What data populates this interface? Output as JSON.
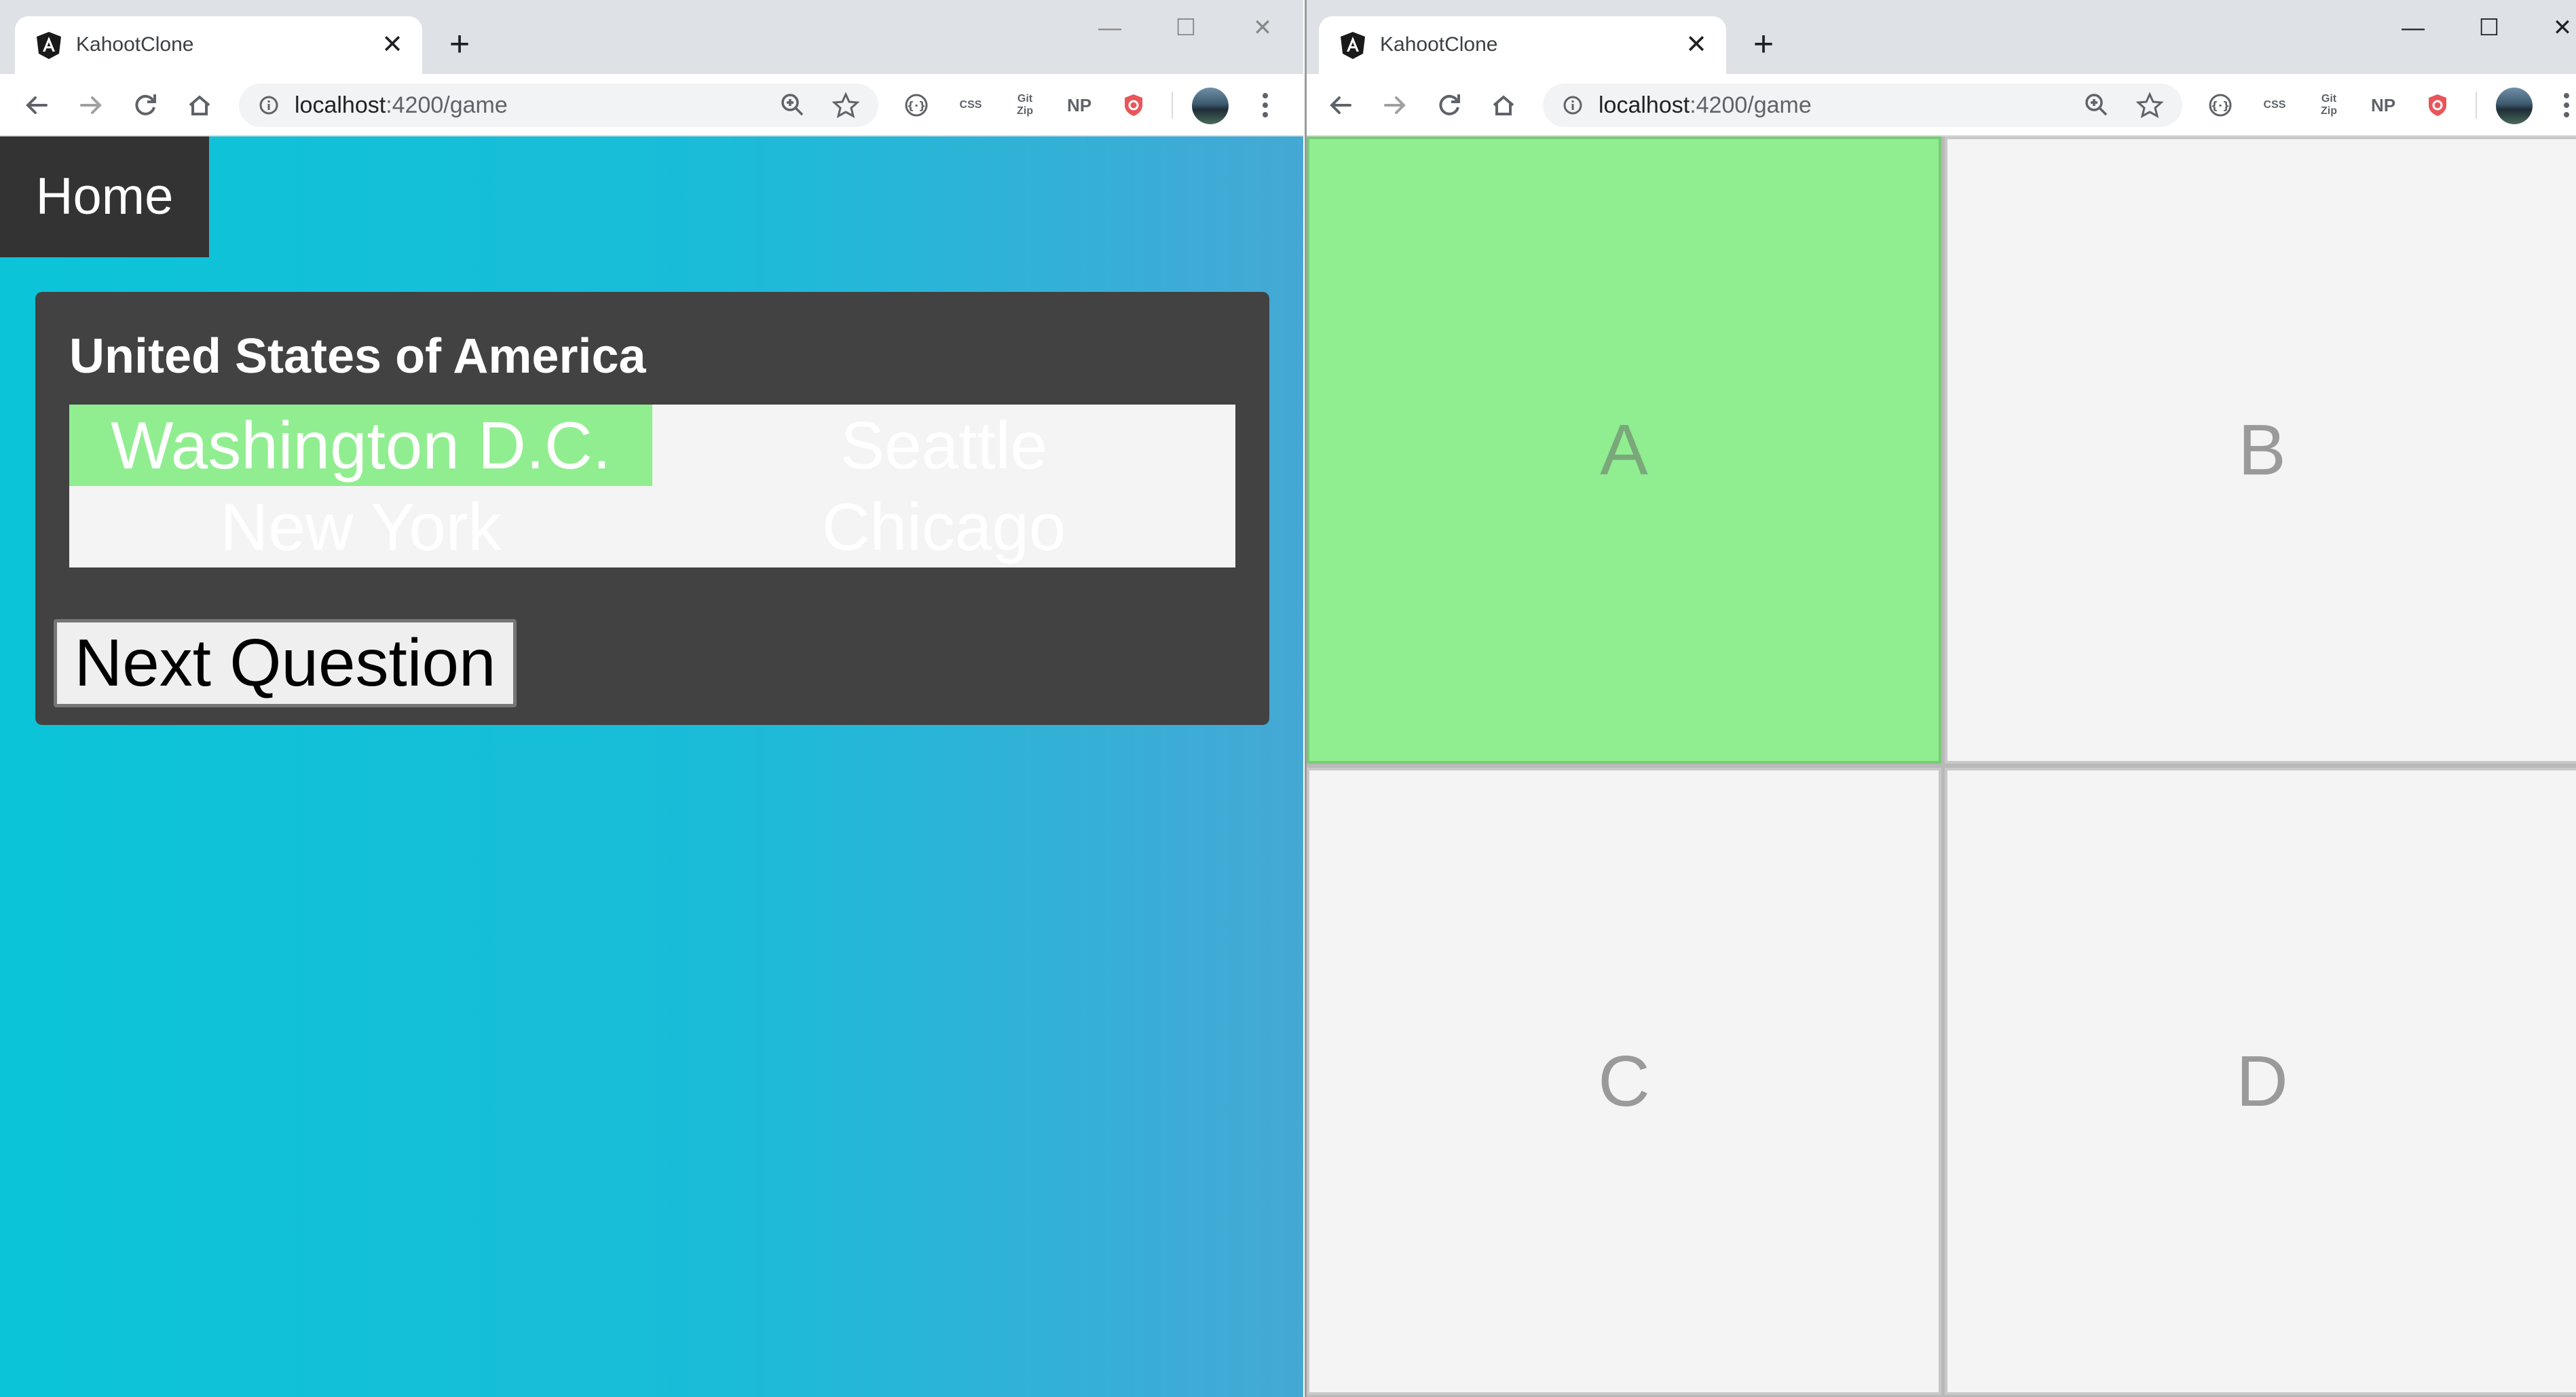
{
  "left_window": {
    "tab": {
      "title": "KahootClone",
      "close_glyph": "✕"
    },
    "new_tab_glyph": "+",
    "controls": {
      "minimize": "—",
      "maximize": "☐",
      "close": "✕"
    },
    "url_host": "localhost",
    "url_rest": ":4200/game",
    "extensions": [
      "CSS",
      "Git Zip",
      "NP"
    ],
    "nav": {
      "home_label": "Home"
    },
    "question": {
      "title": "United States of America",
      "answers": [
        "Washington D.C.",
        "Seattle",
        "New York",
        "Chicago"
      ],
      "highlighted_answer": "Washington D.C."
    },
    "next_button_label": "Next Question"
  },
  "right_window": {
    "tab": {
      "title": "KahootClone",
      "close_glyph": "✕"
    },
    "new_tab_glyph": "+",
    "controls": {
      "minimize": "—",
      "maximize": "☐",
      "close": "✕"
    },
    "url_host": "localhost",
    "url_rest": ":4200/game",
    "extensions": [
      "CSS",
      "Git Zip",
      "NP"
    ],
    "tiles": [
      "A",
      "B",
      "C",
      "D"
    ],
    "selected_tile": "A"
  },
  "colors": {
    "correct_answer": "#90ee90",
    "card_bg": "#424242",
    "gradient_start": "#0bc4d8",
    "gradient_end": "#45a8d5",
    "tile_bg": "#f4f4f4"
  }
}
